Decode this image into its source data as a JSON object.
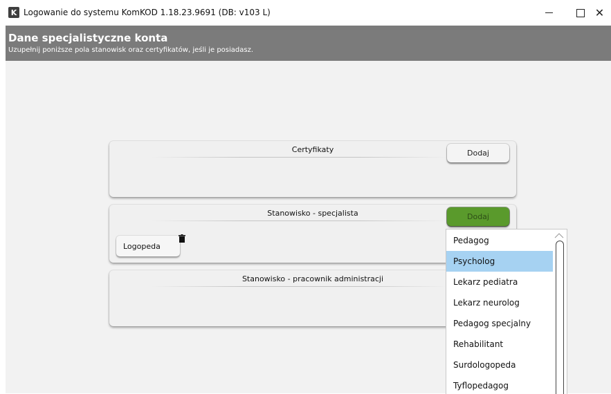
{
  "window": {
    "icon_letter": "K",
    "title": "Logowanie do systemu KomKOD 1.18.23.9691 (DB: v103 L)",
    "close_glyph": "✕"
  },
  "header": {
    "title": "Dane specjalistyczne konta",
    "subtitle": "Uzupełnij poniższe pola stanowisk oraz certyfikatów, jeśli je posiadasz."
  },
  "panels": {
    "certificates": {
      "title": "Certyfikaty",
      "add_label": "Dodaj"
    },
    "specialist": {
      "title": "Stanowisko - specjalista",
      "add_label": "Dodaj",
      "items": [
        {
          "label": "Logopeda"
        }
      ]
    },
    "admin": {
      "title": "Stanowisko - pracownik administracji"
    }
  },
  "dropdown": {
    "items": [
      {
        "label": "Pedagog",
        "selected": false
      },
      {
        "label": "Psycholog",
        "selected": true
      },
      {
        "label": "Lekarz pediatra",
        "selected": false
      },
      {
        "label": "Lekarz neurolog",
        "selected": false
      },
      {
        "label": "Pedagog specjalny",
        "selected": false
      },
      {
        "label": "Rehabilitant",
        "selected": false
      },
      {
        "label": "Surdologopeda",
        "selected": false
      },
      {
        "label": "Tyflopedagog",
        "selected": false
      }
    ]
  },
  "colors": {
    "header_bg": "#7b7b7b",
    "active_button": "#5a9a2c",
    "selected_item": "#a6d2f2"
  }
}
